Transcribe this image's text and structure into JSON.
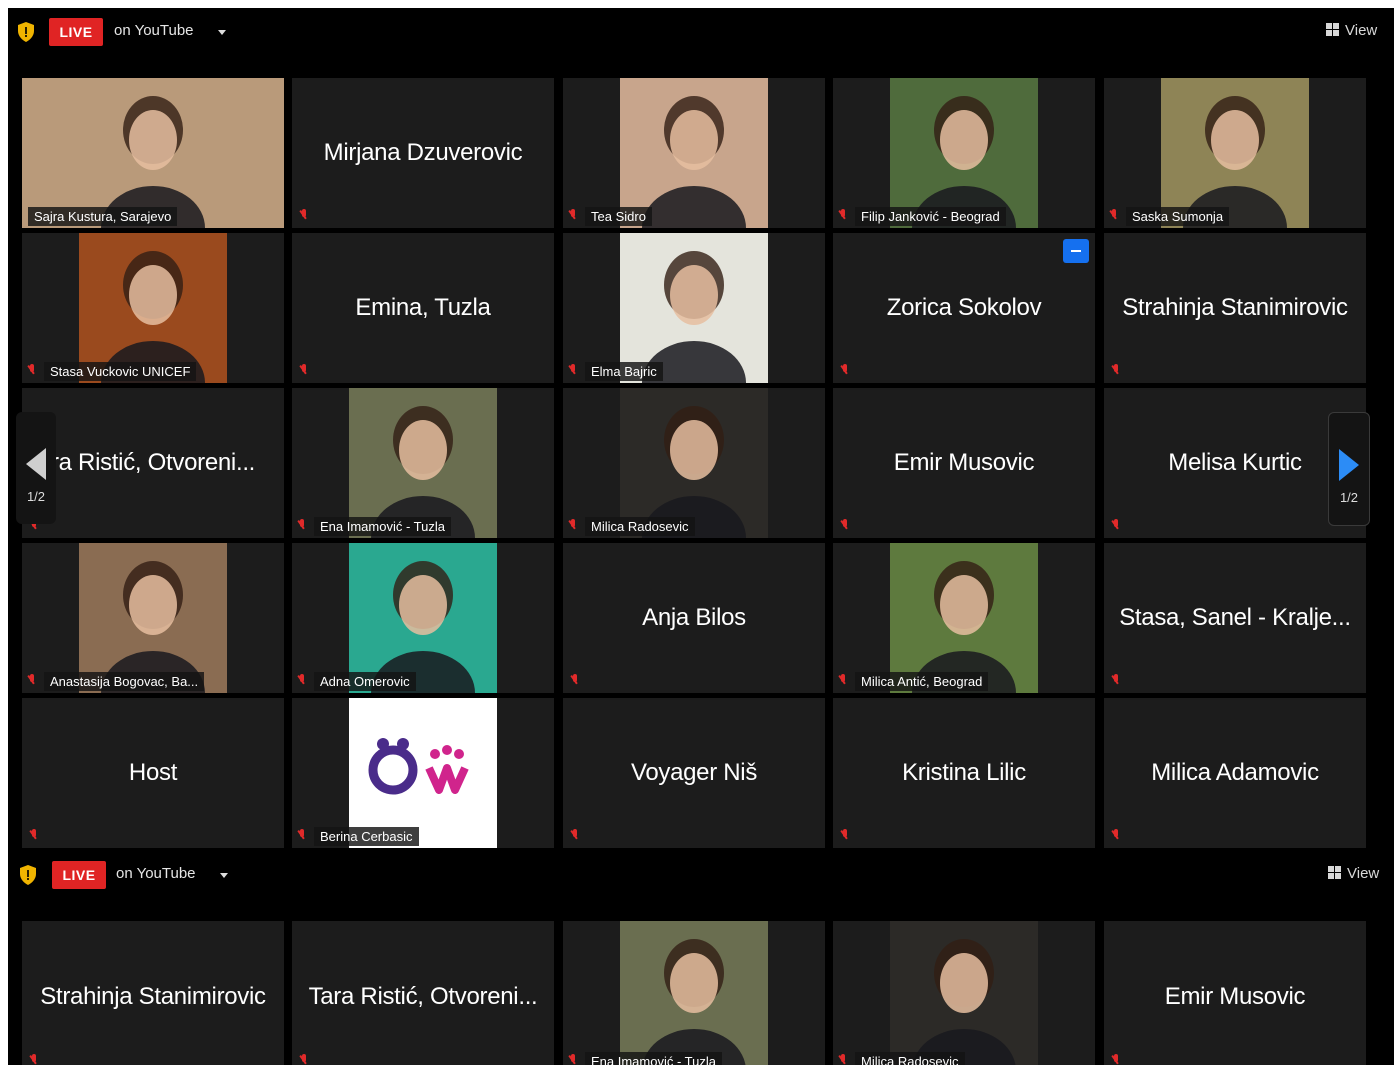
{
  "top_bars": [
    {
      "live": "LIVE",
      "stream": "on YouTube",
      "view": "View"
    },
    {
      "live": "LIVE",
      "stream": "on YouTube",
      "view": "View"
    }
  ],
  "colors": {
    "live_red": "#e02424",
    "active_speaker": "#c9dc3f",
    "mic_muted": "#e12a2a",
    "nav_blue": "#2c8cf6",
    "tile_bg": "#1c1c1c"
  },
  "pager": {
    "left_count": "1/2",
    "right_count": "1/2"
  },
  "grid1": [
    {
      "type": "video",
      "name": "Sajra Kustura, Sarajevo",
      "active": true,
      "bg": "#b99a7a"
    },
    {
      "type": "name",
      "name": "Mirjana Dzuverovic"
    },
    {
      "type": "video",
      "name": "Tea Sidro",
      "bg": "#c8a58c"
    },
    {
      "type": "video",
      "name": "Filip Janković - Beograd",
      "bg": "#4f6b3c"
    },
    {
      "type": "video",
      "name": "Saska Sumonja",
      "bg": "#8e8456"
    },
    {
      "type": "video",
      "name": "Stasa Vuckovic UNICEF",
      "bg": "#9a4a1e"
    },
    {
      "type": "name",
      "name": "Emina, Tuzla"
    },
    {
      "type": "video",
      "name": "Elma Bajric",
      "bg": "#e4e4dc"
    },
    {
      "type": "name",
      "name": "Zorica Sokolov",
      "badge": true
    },
    {
      "type": "name",
      "name": "Strahinja Stanimirovic"
    },
    {
      "type": "name",
      "name": "ra Ristić, Otvoreni..."
    },
    {
      "type": "video",
      "name": "Ena Imamović - Tuzla",
      "bg": "#6a6e50"
    },
    {
      "type": "video",
      "name": "Milica Radosevic",
      "bg": "#2c2a27"
    },
    {
      "type": "name",
      "name": "Emir Musovic"
    },
    {
      "type": "name",
      "name": "Melisa Kurtic"
    },
    {
      "type": "video",
      "name": "Anastasija Bogovac, Ba...",
      "bg": "#8a6c52"
    },
    {
      "type": "video",
      "name": "Adna Omerovic",
      "bg": "#2aa890"
    },
    {
      "type": "name",
      "name": "Anja Bilos"
    },
    {
      "type": "video",
      "name": "Milica Antić, Beograd",
      "bg": "#5e7a3e"
    },
    {
      "type": "name",
      "name": "Stasa, Sanel - Kralje..."
    },
    {
      "type": "name",
      "name": "Host"
    },
    {
      "type": "logo",
      "name": "Berina Cerbasic",
      "bg": "#ffffff"
    },
    {
      "type": "name",
      "name": "Voyager Niš"
    },
    {
      "type": "name",
      "name": "Kristina Lilic"
    },
    {
      "type": "name",
      "name": "Milica Adamovic"
    }
  ],
  "grid2": [
    {
      "type": "name",
      "name": "Strahinja Stanimirovic"
    },
    {
      "type": "name",
      "name": "Tara Ristić, Otvoreni..."
    },
    {
      "type": "video",
      "name": "Ena Imamović - Tuzla",
      "bg": "#6a6e50"
    },
    {
      "type": "video",
      "name": "Milica Radosevic",
      "bg": "#2c2a27"
    },
    {
      "type": "name",
      "name": "Emir Musovic"
    }
  ]
}
